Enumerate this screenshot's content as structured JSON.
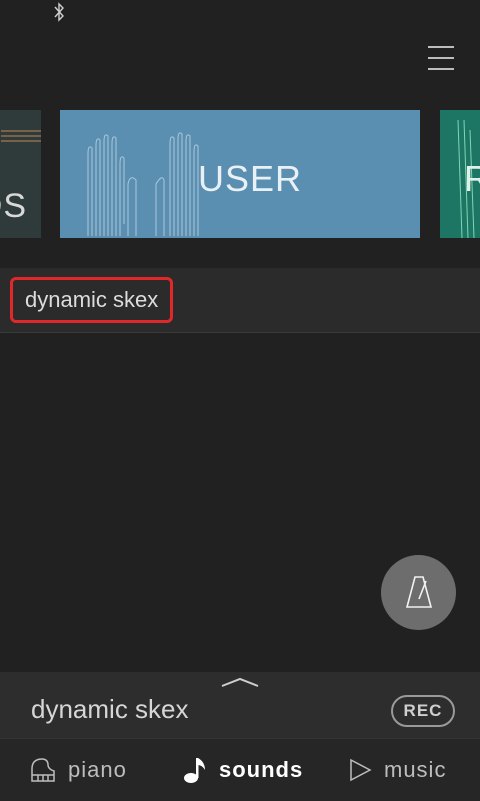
{
  "status_bar": {
    "icon": "bluetooth-icon"
  },
  "header": {
    "menu_icon": "hamburger-menu-icon"
  },
  "carousel": {
    "prev_card": {
      "label": "DS",
      "color": "#2f3a3a"
    },
    "current_card": {
      "label": "USER",
      "color": "#5b8fb1"
    },
    "next_card": {
      "label": "R",
      "color": "#1d7564"
    }
  },
  "preset": {
    "selected_label": "dynamic skex",
    "highlight_color": "#e0282a"
  },
  "metronome": {
    "icon": "metronome-icon"
  },
  "player": {
    "title": "dynamic skex",
    "rec_label": "REC",
    "expand_icon": "chevron-up-icon"
  },
  "tabs": [
    {
      "label": "piano",
      "icon": "piano-icon",
      "active": false
    },
    {
      "label": "sounds",
      "icon": "music-note-icon",
      "active": true
    },
    {
      "label": "music",
      "icon": "play-icon",
      "active": false
    }
  ]
}
